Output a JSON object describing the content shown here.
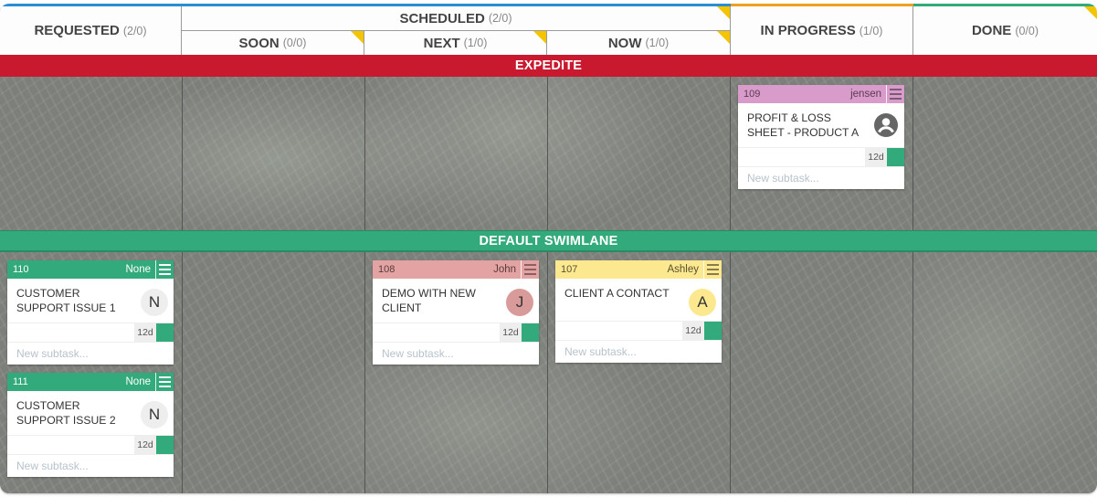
{
  "header": {
    "columns": [
      {
        "name": "REQUESTED",
        "count": "(2/0)"
      },
      {
        "name": "SCHEDULED",
        "count": "(2/0)"
      },
      {
        "name": "IN PROGRESS",
        "count": "(1/0)"
      },
      {
        "name": "DONE",
        "count": "(0/0)"
      }
    ],
    "subcolumns": [
      {
        "name": "SOON",
        "count": "(0/0)"
      },
      {
        "name": "NEXT",
        "count": "(1/0)"
      },
      {
        "name": "NOW",
        "count": "(1/0)"
      }
    ],
    "colors": {
      "requested": "#2a8fd1",
      "scheduled": "#2a8fd1",
      "in_progress": "#f0a020",
      "done": "#33aa7c",
      "wip_corner": "#f5c400"
    }
  },
  "swimlanes": [
    {
      "name": "EXPEDITE",
      "color": "#c8192e"
    },
    {
      "name": "DEFAULT SWIMLANE",
      "color": "#33aa7c"
    }
  ],
  "cards": [
    {
      "id": "109",
      "owner": "jensen",
      "title": "PROFIT & LOSS SHEET - PRODUCT A",
      "avatar": "user-icon",
      "age": "12d",
      "subtask_placeholder": "New subtask...",
      "header_color": "#d99bc9",
      "column": "IN PROGRESS",
      "lane": "EXPEDITE"
    },
    {
      "id": "110",
      "owner": "None",
      "title": "CUSTOMER SUPPORT ISSUE 1",
      "avatar": "N",
      "age": "12d",
      "subtask_placeholder": "New subtask...",
      "header_color": "#33aa7c",
      "column": "REQUESTED",
      "lane": "DEFAULT SWIMLANE"
    },
    {
      "id": "111",
      "owner": "None",
      "title": "CUSTOMER SUPPORT ISSUE 2",
      "avatar": "N",
      "age": "12d",
      "subtask_placeholder": "New subtask...",
      "header_color": "#33aa7c",
      "column": "REQUESTED",
      "lane": "DEFAULT SWIMLANE"
    },
    {
      "id": "108",
      "owner": "John",
      "title": "DEMO WITH NEW CLIENT",
      "avatar": "J",
      "age": "12d",
      "subtask_placeholder": "New subtask...",
      "header_color": "#e3a3a3",
      "column": "NEXT",
      "lane": "DEFAULT SWIMLANE"
    },
    {
      "id": "107",
      "owner": "Ashley",
      "title": "CLIENT A CONTACT",
      "avatar": "A",
      "age": "12d",
      "subtask_placeholder": "New subtask...",
      "header_color": "#fce88f",
      "column": "NOW",
      "lane": "DEFAULT SWIMLANE"
    }
  ]
}
